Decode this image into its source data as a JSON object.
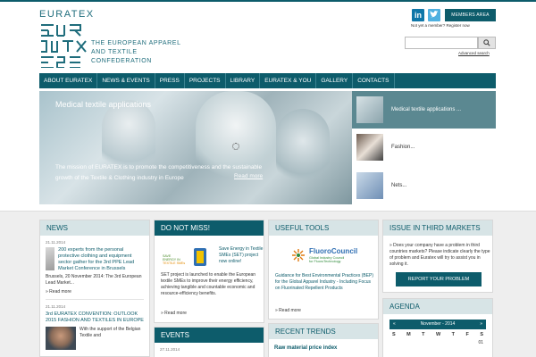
{
  "colors": {
    "brand": "#0d5c6b",
    "nav_separator": "#3b8391",
    "band": "#eeeeee"
  },
  "header": {
    "logo_word": "EURATEX",
    "logo_tag_line1": "THE EUROPEAN APPAREL",
    "logo_tag_line2": "AND TEXTILE CONFEDERATION",
    "linkedin_icon": "in",
    "twitter_icon": "twitter-bird",
    "members_label": "MEMBERS AREA",
    "register_note": "Not yet a member? Register now",
    "search_placeholder": "",
    "search_icon": "magnifier",
    "advanced_search": "Advanced search"
  },
  "nav": {
    "items": [
      "ABOUT EURATEX",
      "NEWS & EVENTS",
      "PRESS",
      "PROJECTS",
      "LIBRARY",
      "EURATEX & YOU",
      "GALLERY",
      "CONTACTS"
    ]
  },
  "slider": {
    "title": "Medical textile applications",
    "text": "The mission of EURATEX is to promote the competitiveness and the sustainable growth of the Textile & Clothing industry in Europe",
    "read_more": "Read more"
  },
  "thumbs": [
    {
      "label": "Medical textile applications ..."
    },
    {
      "label": "Fashion..."
    },
    {
      "label": "Nets..."
    }
  ],
  "news": {
    "heading": "NEWS",
    "items": [
      {
        "date": "21.11.2014",
        "title": "200 experts from the personal protective clothing and equipment sector gather for the 3rd PPE Lead Market Conference in Brussels",
        "body": "Brussels, 20 November 2014: The 3rd European Lead Market...",
        "readmore": "Read more"
      },
      {
        "date": "21.11.2014",
        "title": "3rd EURATEX CONVENTION: OUTLOOK 2015 FASHION AND TEXTILES IN EUROPE",
        "body": "With the support of the Belgian Textile and",
        "readmore": ""
      }
    ]
  },
  "dont_miss": {
    "heading": "DO NOT MISS!",
    "logo_text": "SAVE ENERGY IN TEXTILE SMEs",
    "title": "Save Energy in Textile SMEs (SET) project now online!",
    "body": "SET project is launched to enable the European textile SMEs to improve their energy efficiency, achieving tangible and countable economic and resource-efficiency benefits.",
    "readmore": "Read more"
  },
  "events": {
    "heading": "EVENTS",
    "date": "27.11.2014"
  },
  "tools": {
    "heading": "USEFUL TOOLS",
    "logo_name": "FluoroCouncil",
    "logo_sub1": "Global Industry Council",
    "logo_sub2": "for FluoroTechnology",
    "body": "Guidance for Best Environmental Practices (BEP) for the Global Apparel Industry - Including Focus on Fluorinated Repellent Products",
    "readmore": "Read more"
  },
  "trends": {
    "heading": "RECENT TRENDS",
    "link": "Raw material price index"
  },
  "issue": {
    "heading": "ISSUE IN THIRD MARKETS",
    "body": "Does your company have a problem in third countries markets? Please indicate clearly the type of problem and Euratex will try to assist you in solving it.",
    "button": "REPORT YOUR PROBLEM"
  },
  "agenda": {
    "heading": "AGENDA",
    "month": "November - 2014",
    "prev": "«",
    "next": "»",
    "days": [
      "S",
      "M",
      "T",
      "W",
      "T",
      "F",
      "S"
    ],
    "first_row_last": "01"
  }
}
